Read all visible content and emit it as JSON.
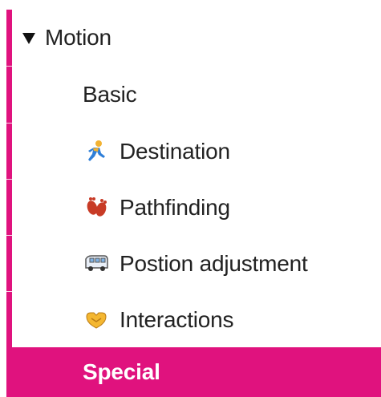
{
  "section": {
    "label": "Motion",
    "expanded": true
  },
  "items": [
    {
      "label": "Basic",
      "icon": ""
    },
    {
      "label": "Destination",
      "icon": "running-person-icon"
    },
    {
      "label": "Pathfinding",
      "icon": "footprints-icon"
    },
    {
      "label": "Postion adjustment",
      "icon": "minibus-icon"
    },
    {
      "label": "Interactions",
      "icon": "handshake-icon"
    },
    {
      "label": "Special",
      "icon": "",
      "selected": true
    }
  ],
  "colors": {
    "accent": "#e0127e",
    "text": "#222222",
    "selected_text": "#ffffff"
  }
}
